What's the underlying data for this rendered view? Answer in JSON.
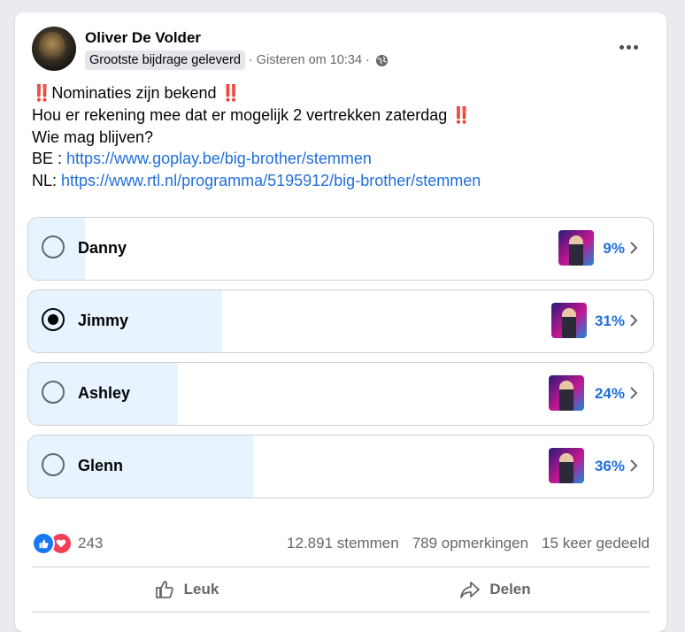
{
  "post": {
    "author": "Oliver De Volder",
    "badge": "Grootste bijdrage geleverd",
    "separator": "·",
    "timestamp": "Gisteren om 10:34",
    "text_line1": "Nominaties zijn bekend",
    "text_line2": "Hou er rekening mee dat er mogelijk 2 vertrekken zaterdag",
    "text_line3": "Wie mag blijven?",
    "be_label": "BE :",
    "be_link": "https://www.goplay.be/big-brother/stemmen",
    "nl_label": "NL:",
    "nl_link": "https://www.rtl.nl/programma/5195912/big-brother/stemmen",
    "emoji": "‼️"
  },
  "poll": {
    "options": [
      {
        "label": "Danny",
        "percent": "9%",
        "fraction": 0.09,
        "selected": false
      },
      {
        "label": "Jimmy",
        "percent": "31%",
        "fraction": 0.31,
        "selected": true
      },
      {
        "label": "Ashley",
        "percent": "24%",
        "fraction": 0.24,
        "selected": false
      },
      {
        "label": "Glenn",
        "percent": "36%",
        "fraction": 0.36,
        "selected": false
      }
    ]
  },
  "footer": {
    "reaction_count": "243",
    "votes": "12.891 stemmen",
    "comments": "789 opmerkingen",
    "shares": "15 keer gedeeld",
    "like_label": "Leuk",
    "share_label": "Delen"
  },
  "colors": {
    "link": "#216fdb",
    "poll_fill": "#e7f3ff",
    "like": "#1877f2",
    "love": "#f33e58"
  }
}
